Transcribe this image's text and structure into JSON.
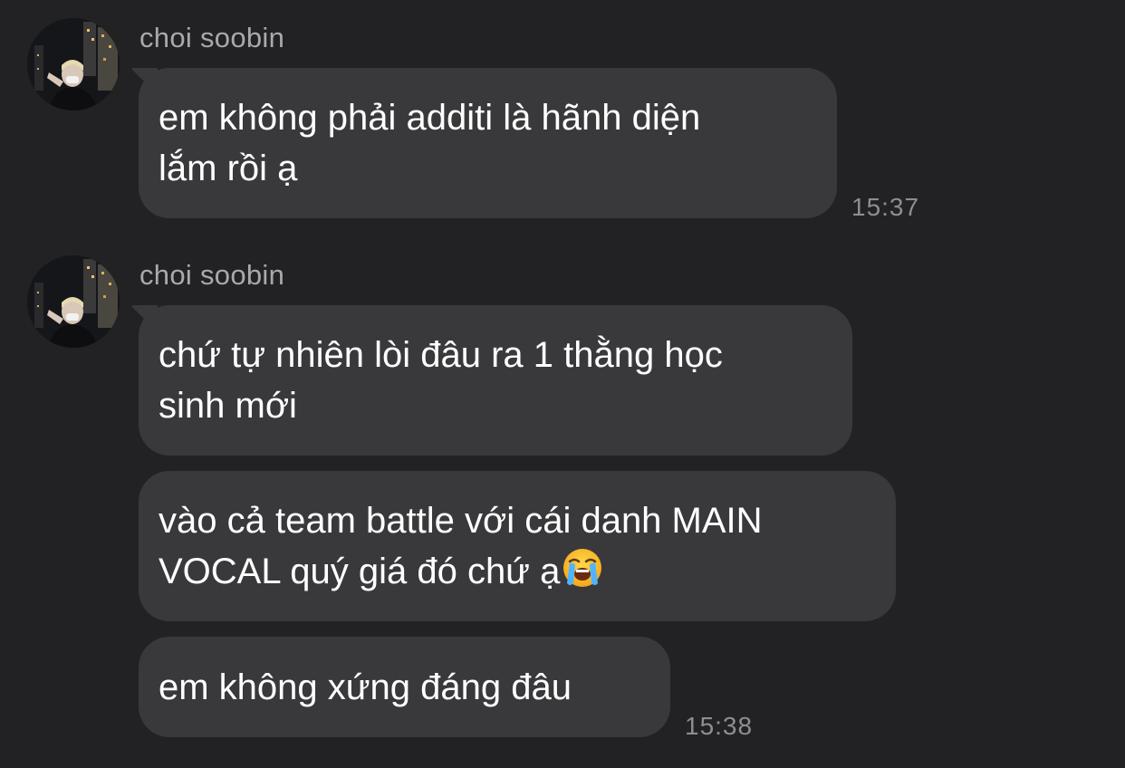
{
  "messages": [
    {
      "sender": "choi soobin",
      "lines": [
        "em không phải additi là hãnh diện",
        "lắm rồi ạ"
      ],
      "time": "15:37"
    },
    {
      "sender": "choi soobin",
      "lines": [
        "chứ tự nhiên lòi đâu ra 1 thằng học",
        "sinh mới"
      ]
    },
    {
      "lines": [
        "vào cả team battle với cái danh MAIN",
        "VOCAL quý giá đó chứ ạ"
      ],
      "emoji": "loudly-crying-face-icon"
    },
    {
      "lines": [
        "em không xứng đáng đâu"
      ],
      "time": "15:38"
    }
  ],
  "colors": {
    "background": "#222224",
    "bubble": "#39393c",
    "text": "#ffffff",
    "sender": "#a9a9ad",
    "time": "#8e8e92"
  }
}
